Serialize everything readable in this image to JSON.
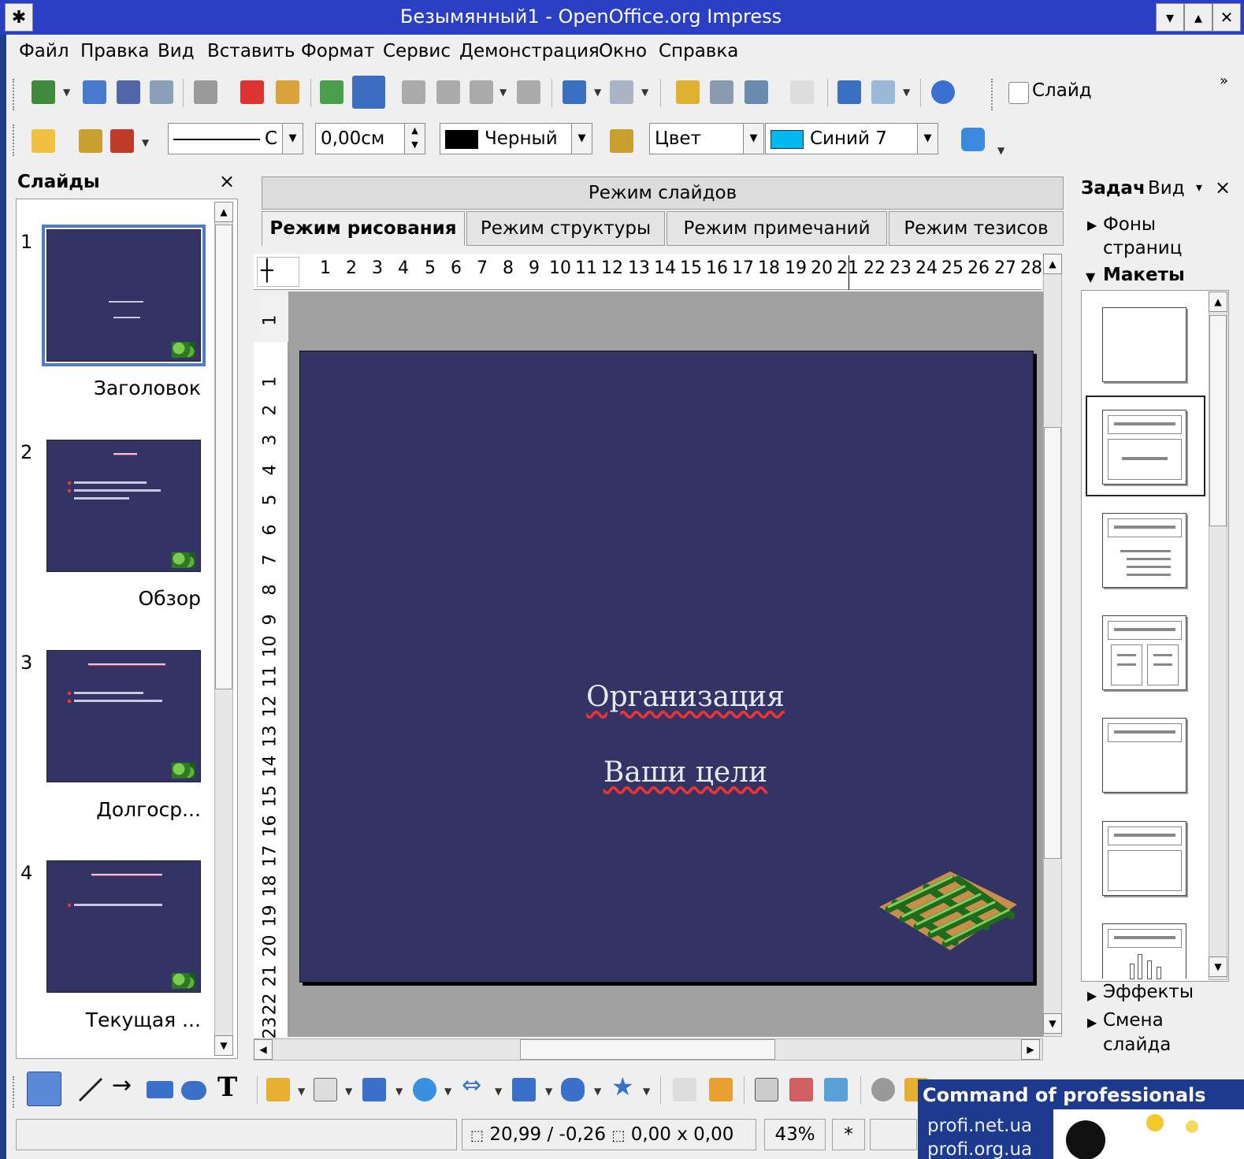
{
  "window": {
    "title": "Безымянный1 - OpenOffice.org Impress",
    "pin_glyph": "✱",
    "controls": [
      "▾",
      "▴",
      "✕"
    ]
  },
  "menu": [
    "Файл",
    "Правка",
    "Вид",
    "Вставить",
    "Формат",
    "Сервис",
    "Демонстрация",
    "Окно",
    "Справка"
  ],
  "standard_toolbar": {
    "slide_button": "Слайд",
    "overflow": "»"
  },
  "line_toolbar": {
    "line_style": "С",
    "line_width": "0,00см",
    "line_color": "Черный",
    "area_style": "Цвет",
    "area_color": "Синий 7",
    "line_color_hex": "#000000",
    "area_color_hex": "#00b8f0"
  },
  "slides_panel": {
    "title": "Слайды",
    "close": "×",
    "slides": [
      {
        "number": "1",
        "label": "Заголовок"
      },
      {
        "number": "2",
        "label": "Обзор"
      },
      {
        "number": "3",
        "label": "Долгоср..."
      },
      {
        "number": "4",
        "label": "Текущая ..."
      }
    ]
  },
  "view_tabs": {
    "top": "Режим слайдов",
    "tabs": [
      "Режим рисования",
      "Режим структуры",
      "Режим примечаний",
      "Режим тезисов"
    ],
    "active": "Режим рисования"
  },
  "ruler": {
    "corner": "┼",
    "h": [
      "1",
      "2",
      "3",
      "4",
      "5",
      "6",
      "7",
      "8",
      "9",
      "10",
      "11",
      "12",
      "13",
      "14",
      "15",
      "16",
      "17",
      "18",
      "19",
      "20",
      "21",
      "22",
      "23",
      "24",
      "25",
      "26",
      "27",
      "28"
    ],
    "v_top": "1",
    "v": [
      "1",
      "2",
      "3",
      "4",
      "5",
      "6",
      "7",
      "8",
      "9",
      "10",
      "11",
      "12",
      "13",
      "14",
      "15",
      "16",
      "17",
      "18",
      "19",
      "20",
      "21",
      "22",
      "23"
    ]
  },
  "slide": {
    "line1": "Организация",
    "line2": "Ваши цели",
    "background_hex": "#333366"
  },
  "task_pane": {
    "title": "Задач",
    "view": "Вид",
    "dropdown": "▾",
    "close": "×",
    "sections": {
      "backgrounds": "Фоны страниц",
      "layouts": "Макеты",
      "effects": "Эффекты",
      "transition": "Смена слайда"
    }
  },
  "status": {
    "position": "20,99 / -0,26",
    "size": "0,00 x 0,00",
    "zoom": "43%",
    "modified": "*"
  },
  "watermark": {
    "heading": "Command of professionals",
    "site1": "profi.net.ua",
    "site2": "profi.org.ua"
  }
}
